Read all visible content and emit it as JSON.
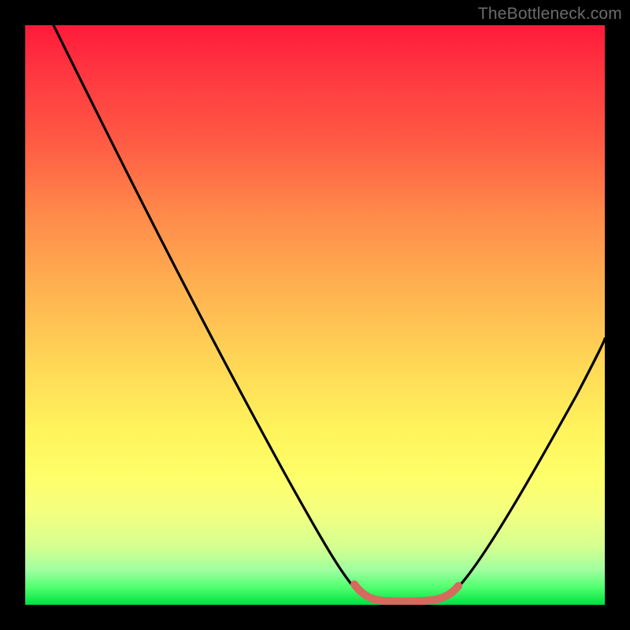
{
  "watermark": "TheBottleneck.com",
  "chart_data": {
    "type": "line",
    "title": "",
    "xlabel": "",
    "ylabel": "",
    "xlim": [
      0,
      100
    ],
    "ylim": [
      0,
      100
    ],
    "series": [
      {
        "name": "black-curve",
        "color": "#000000",
        "x": [
          5,
          10,
          15,
          20,
          25,
          30,
          35,
          40,
          45,
          50,
          55,
          58,
          60,
          63,
          66,
          69,
          72,
          75,
          80,
          85,
          90,
          95,
          100
        ],
        "values": [
          100,
          91,
          82,
          73,
          64,
          55,
          46,
          37,
          28,
          19,
          10,
          5,
          2,
          0,
          0,
          0,
          0,
          2,
          8,
          16,
          25,
          35,
          46
        ]
      },
      {
        "name": "red-segment",
        "color": "#d56a5e",
        "x": [
          58,
          60,
          63,
          66,
          69,
          72,
          74
        ],
        "values": [
          4,
          1.5,
          0.8,
          0.8,
          0.8,
          1.2,
          3
        ]
      }
    ],
    "gradient_stops": [
      {
        "pos": 0,
        "color": "#ff1a3a"
      },
      {
        "pos": 50,
        "color": "#ffc050"
      },
      {
        "pos": 80,
        "color": "#fff860"
      },
      {
        "pos": 100,
        "color": "#00e040"
      }
    ]
  }
}
